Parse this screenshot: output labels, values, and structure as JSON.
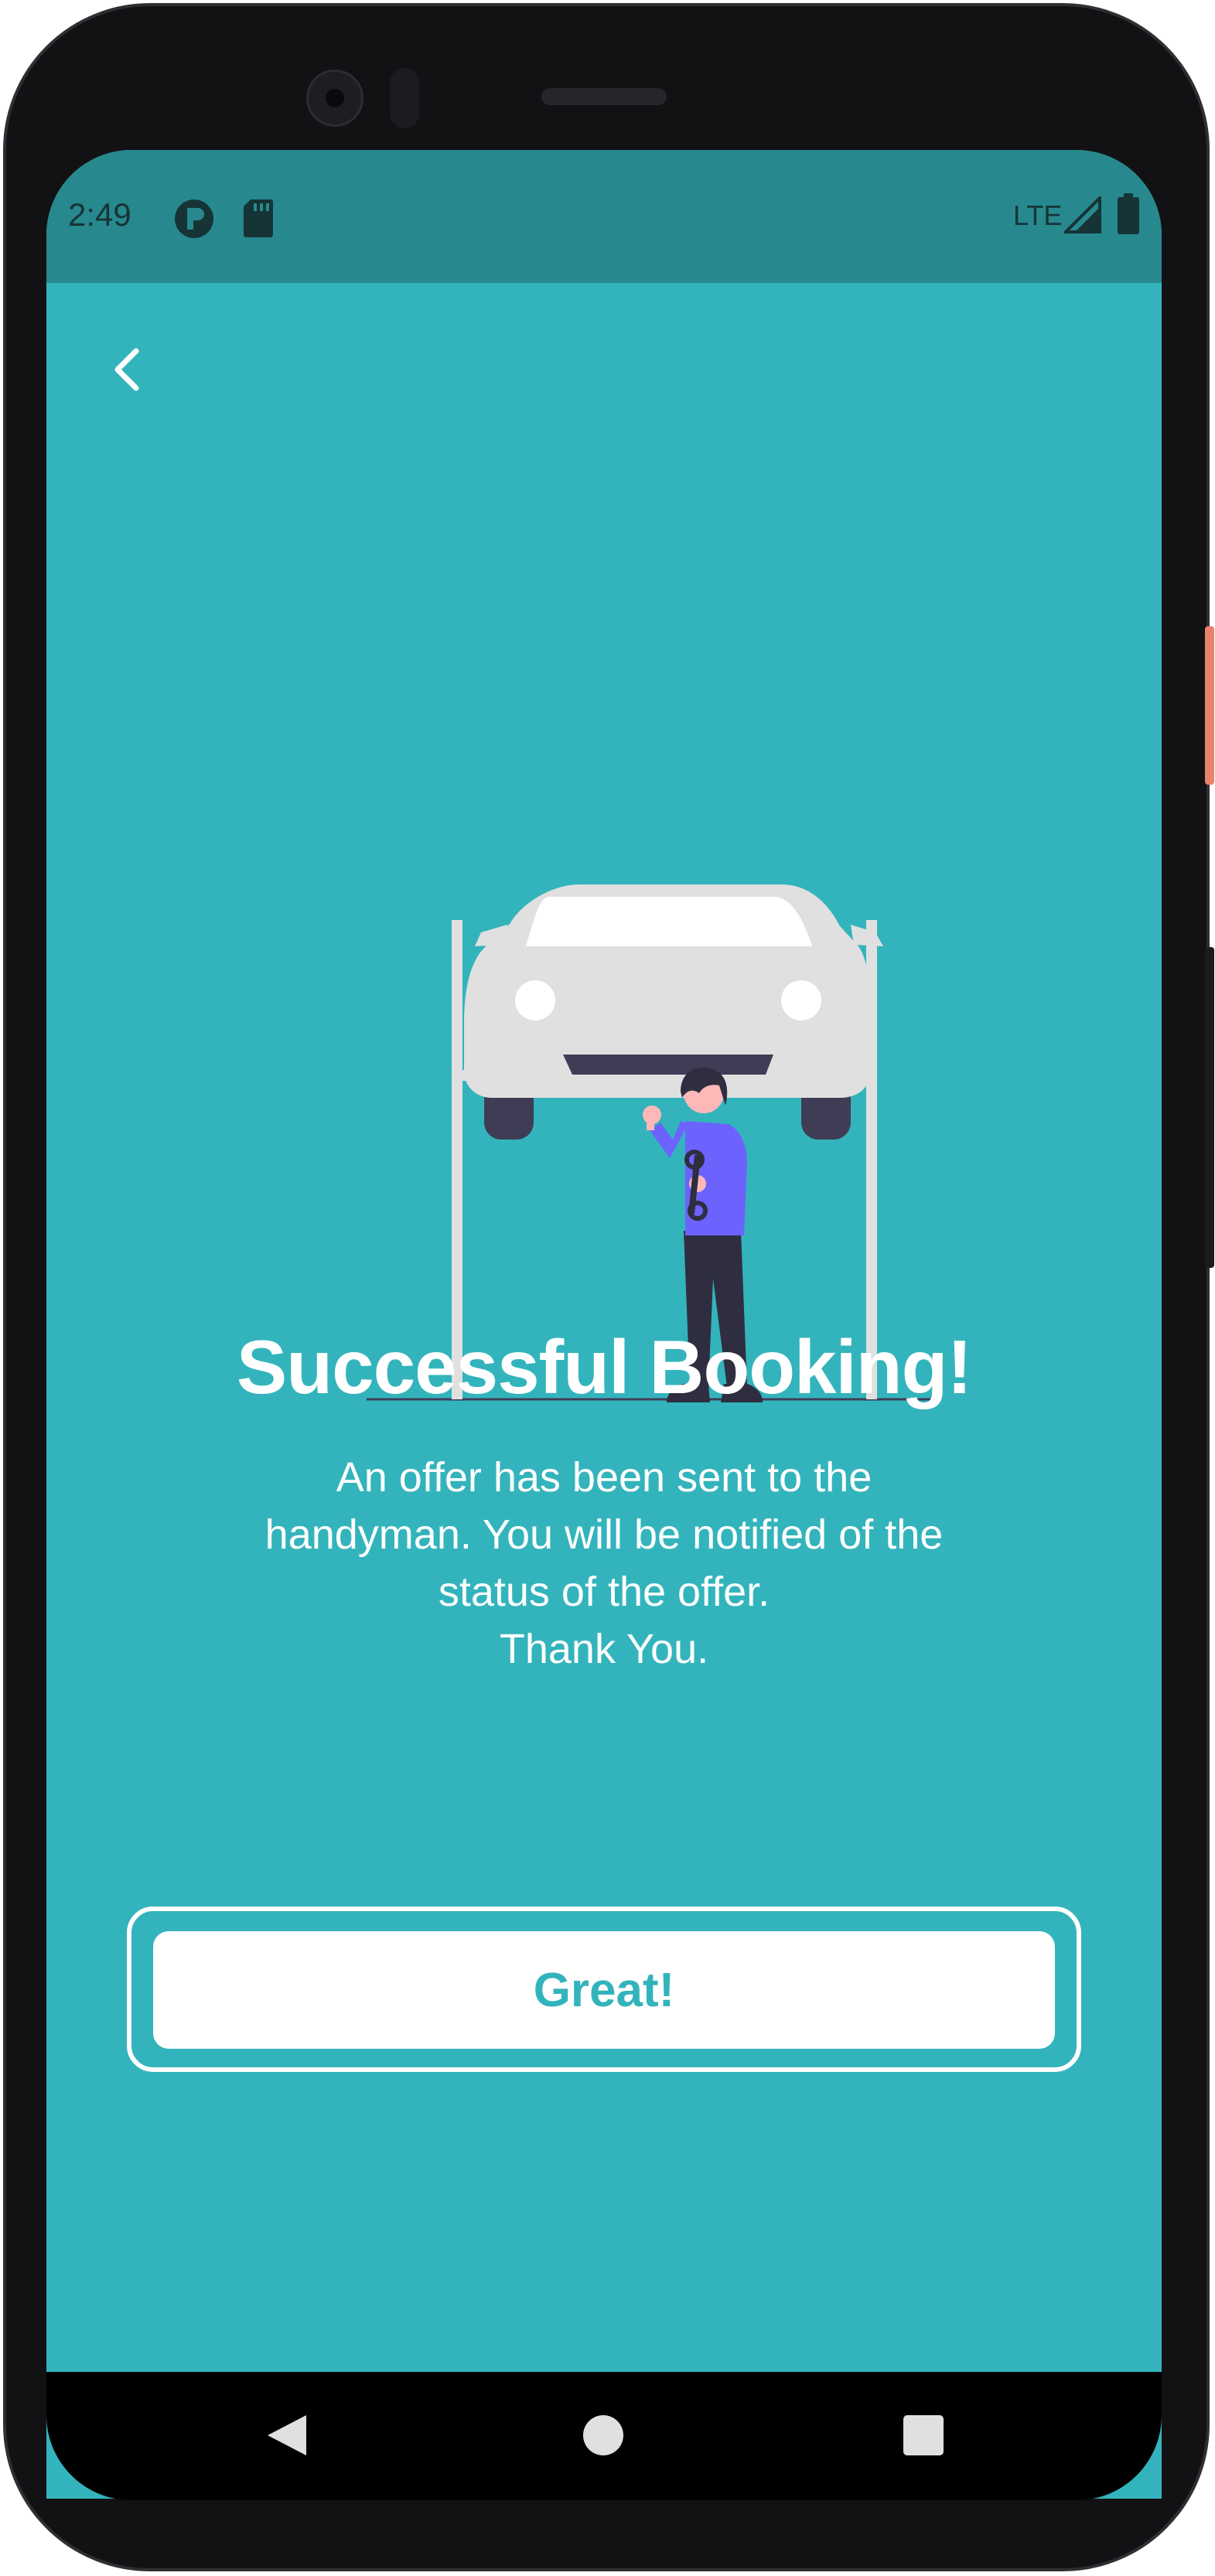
{
  "status_bar": {
    "time": "2:49",
    "network": "LTE",
    "icons": [
      "app-notification-icon",
      "sd-card-icon",
      "signal-icon",
      "battery-icon"
    ]
  },
  "header": {
    "back_icon": "chevron-left-icon"
  },
  "illustration": {
    "description_icon": "mechanic-car-lift-illustration"
  },
  "content": {
    "title": "Successful Booking!",
    "message_lines": [
      "An offer has been sent to the",
      "handyman. You will be notified of the",
      "status of the offer.",
      "Thank You."
    ]
  },
  "actions": {
    "great_label": "Great!"
  },
  "nav_bar": {
    "icons": [
      "nav-back-icon",
      "nav-home-icon",
      "nav-recents-icon"
    ]
  },
  "colors": {
    "screen_bg": "#33b4bc",
    "status_bar_bg": "#27898e",
    "accent_text": "#33b4bc",
    "illustration_shirt": "#6c63ff",
    "illustration_car": "#e0e0e0",
    "illustration_dark": "#3f3d56"
  }
}
